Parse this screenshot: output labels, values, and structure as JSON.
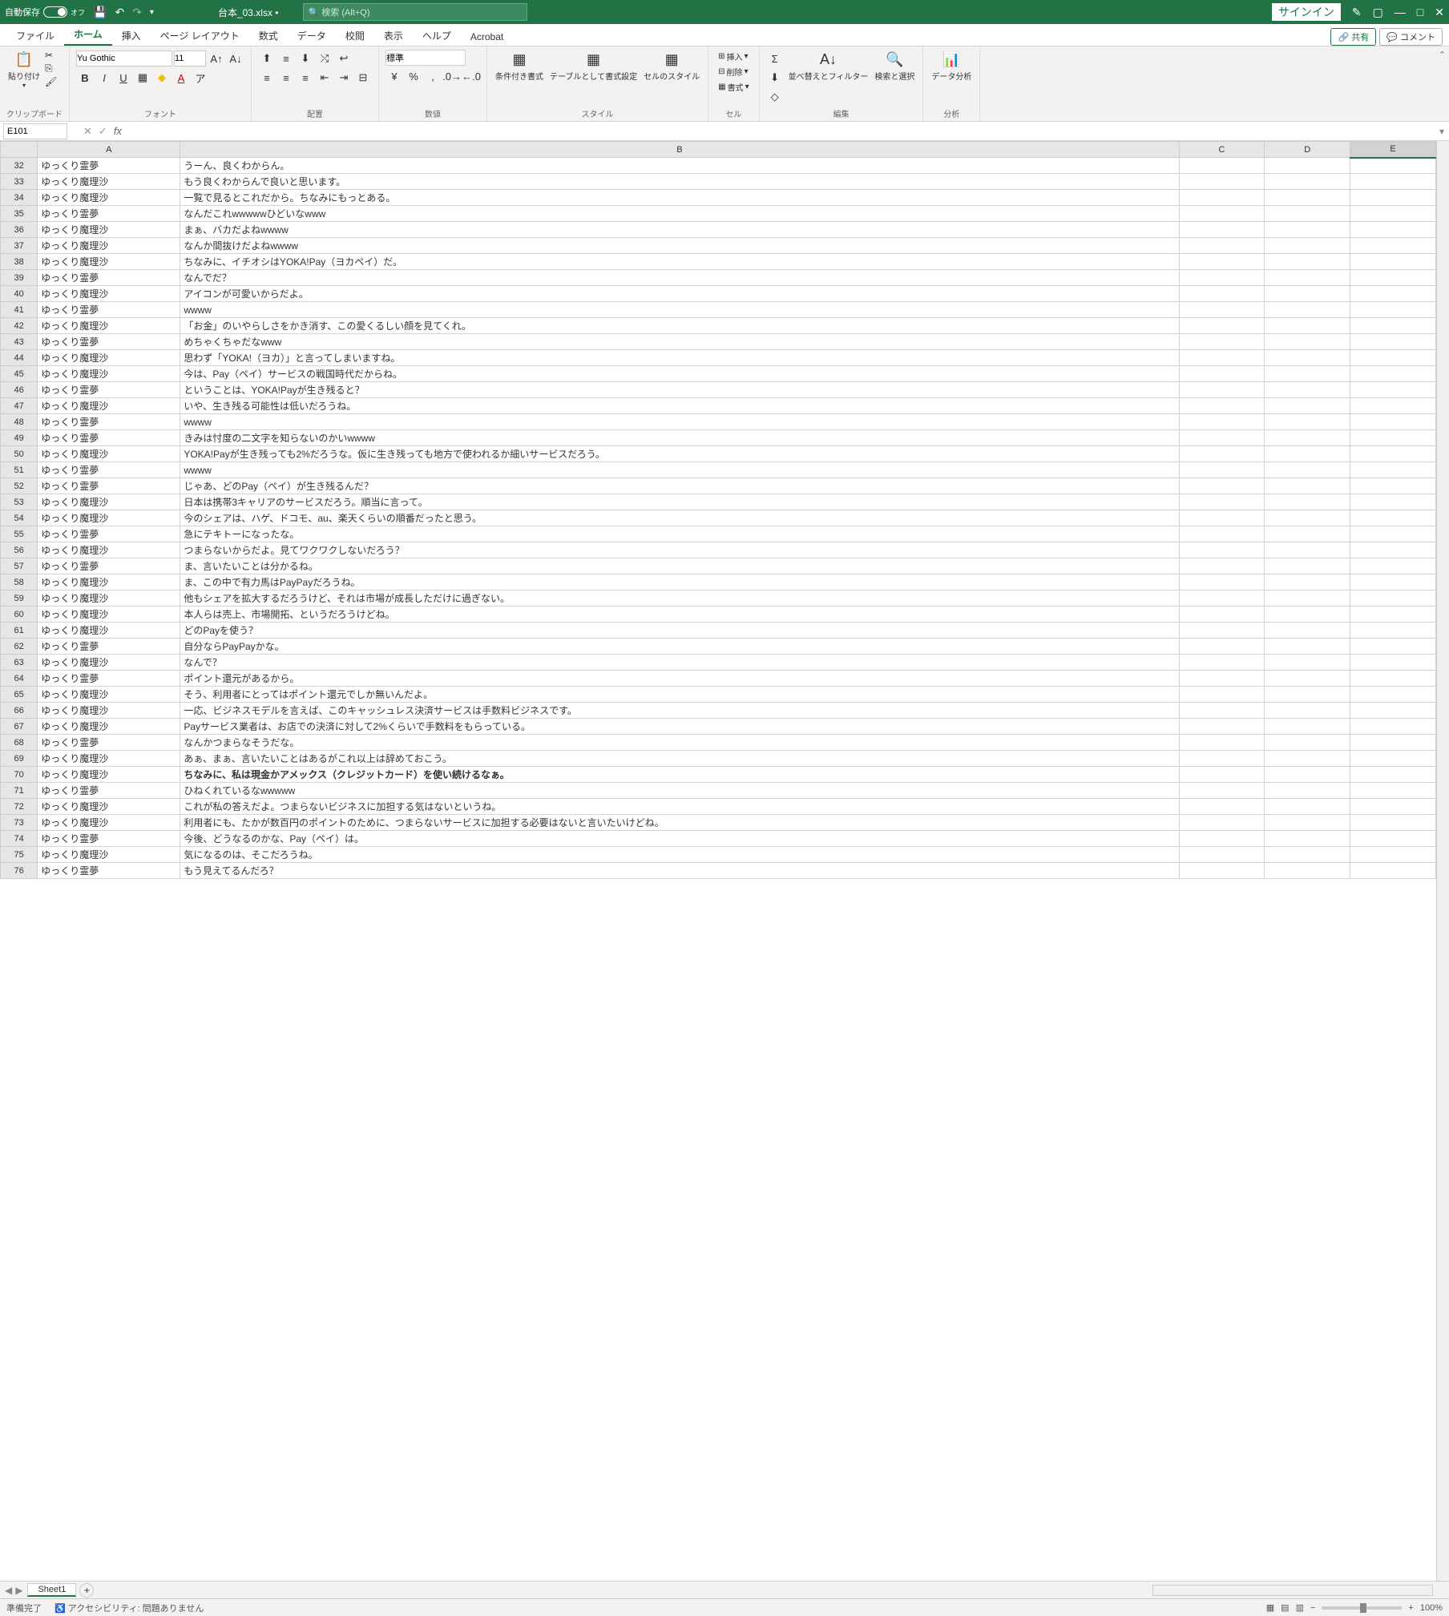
{
  "titlebar": {
    "autosave": "自動保存",
    "autosave_state": "オフ",
    "filename": "台本_03.xlsx •",
    "search_placeholder": "検索 (Alt+Q)",
    "signin": "サインイン"
  },
  "tabs": {
    "file": "ファイル",
    "home": "ホーム",
    "insert": "挿入",
    "layout": "ページ レイアウト",
    "formulas": "数式",
    "data": "データ",
    "review": "校閲",
    "view": "表示",
    "help": "ヘルプ",
    "acrobat": "Acrobat",
    "share": "共有",
    "comment": "コメント"
  },
  "ribbon": {
    "clipboard": "クリップボード",
    "paste": "貼り付け",
    "font_group": "フォント",
    "font_name": "Yu Gothic",
    "font_size": "11",
    "align": "配置",
    "number": "数値",
    "number_format": "標準",
    "style": "スタイル",
    "cond": "条件付き書式",
    "table_fmt": "テーブルとして書式設定",
    "cell_style": "セルのスタイル",
    "cell": "セル",
    "insert_c": "挿入",
    "delete_c": "削除",
    "format_c": "書式",
    "edit": "編集",
    "sort": "並べ替えとフィルター",
    "find": "検索と選択",
    "analysis": "分析",
    "data_analysis": "データ分析"
  },
  "namebox": "E101",
  "cols": [
    "A",
    "B",
    "C",
    "D",
    "E"
  ],
  "rows": [
    {
      "n": 32,
      "a": "ゆっくり霊夢",
      "b": "うーん、良くわからん。"
    },
    {
      "n": 33,
      "a": "ゆっくり魔理沙",
      "b": "もう良くわからんで良いと思います。"
    },
    {
      "n": 34,
      "a": "ゆっくり魔理沙",
      "b": "一覧で見るとこれだから。ちなみにもっとある。"
    },
    {
      "n": 35,
      "a": "ゆっくり霊夢",
      "b": "なんだこれwwwwwひどいなwww"
    },
    {
      "n": 36,
      "a": "ゆっくり魔理沙",
      "b": "まぁ、バカだよねwwww"
    },
    {
      "n": 37,
      "a": "ゆっくり魔理沙",
      "b": "なんか間抜けだよねwwww"
    },
    {
      "n": 38,
      "a": "ゆっくり魔理沙",
      "b": "ちなみに、イチオシはYOKA!Pay（ヨカペイ）だ。"
    },
    {
      "n": 39,
      "a": "ゆっくり霊夢",
      "b": "なんでだ？"
    },
    {
      "n": 40,
      "a": "ゆっくり魔理沙",
      "b": "アイコンが可愛いからだよ。"
    },
    {
      "n": 41,
      "a": "ゆっくり霊夢",
      "b": "wwww"
    },
    {
      "n": 42,
      "a": "ゆっくり魔理沙",
      "b": "「お金」のいやらしさをかき消す、この愛くるしい顔を見てくれ。"
    },
    {
      "n": 43,
      "a": "ゆっくり霊夢",
      "b": "めちゃくちゃだなwww"
    },
    {
      "n": 44,
      "a": "ゆっくり魔理沙",
      "b": "思わず「YOKA!（ヨカ）」と言ってしまいますね。"
    },
    {
      "n": 45,
      "a": "ゆっくり魔理沙",
      "b": "今は、Pay（ペイ）サービスの戦国時代だからね。"
    },
    {
      "n": 46,
      "a": "ゆっくり霊夢",
      "b": "ということは、YOKA!Payが生き残ると？"
    },
    {
      "n": 47,
      "a": "ゆっくり魔理沙",
      "b": "いや、生き残る可能性は低いだろうね。"
    },
    {
      "n": 48,
      "a": "ゆっくり霊夢",
      "b": "wwww"
    },
    {
      "n": 49,
      "a": "ゆっくり霊夢",
      "b": "きみは忖度の二文字を知らないのかいwwww"
    },
    {
      "n": 50,
      "a": "ゆっくり魔理沙",
      "b": "YOKA!Payが生き残っても2%だろうな。仮に生き残っても地方で使われるか細いサービスだろう。"
    },
    {
      "n": 51,
      "a": "ゆっくり霊夢",
      "b": "wwww"
    },
    {
      "n": 52,
      "a": "ゆっくり霊夢",
      "b": "じゃあ、どのPay（ペイ）が生き残るんだ？"
    },
    {
      "n": 53,
      "a": "ゆっくり魔理沙",
      "b": "日本は携帯3キャリアのサービスだろう。順当に言って。"
    },
    {
      "n": 54,
      "a": "ゆっくり魔理沙",
      "b": "今のシェアは、ハゲ、ドコモ、au、楽天くらいの順番だったと思う。"
    },
    {
      "n": 55,
      "a": "ゆっくり霊夢",
      "b": "急にテキトーになったな。"
    },
    {
      "n": 56,
      "a": "ゆっくり魔理沙",
      "b": "つまらないからだよ。見てワクワクしないだろう？"
    },
    {
      "n": 57,
      "a": "ゆっくり霊夢",
      "b": "ま、言いたいことは分かるね。"
    },
    {
      "n": 58,
      "a": "ゆっくり魔理沙",
      "b": "ま、この中で有力馬はPayPayだろうね。"
    },
    {
      "n": 59,
      "a": "ゆっくり魔理沙",
      "b": "他もシェアを拡大するだろうけど、それは市場が成長しただけに過ぎない。"
    },
    {
      "n": 60,
      "a": "ゆっくり魔理沙",
      "b": "本人らは売上、市場開拓、というだろうけどね。"
    },
    {
      "n": 61,
      "a": "ゆっくり魔理沙",
      "b": "どのPayを使う？"
    },
    {
      "n": 62,
      "a": "ゆっくり霊夢",
      "b": "自分ならPayPayかな。"
    },
    {
      "n": 63,
      "a": "ゆっくり魔理沙",
      "b": "なんで？"
    },
    {
      "n": 64,
      "a": "ゆっくり霊夢",
      "b": "ポイント還元があるから。"
    },
    {
      "n": 65,
      "a": "ゆっくり魔理沙",
      "b": "そう、利用者にとってはポイント還元でしか無いんだよ。"
    },
    {
      "n": 66,
      "a": "ゆっくり魔理沙",
      "b": "一応、ビジネスモデルを言えば、このキャッシュレス決済サービスは手数料ビジネスです。"
    },
    {
      "n": 67,
      "a": "ゆっくり魔理沙",
      "b": "Payサービス業者は、お店での決済に対して2%くらいで手数料をもらっている。"
    },
    {
      "n": 68,
      "a": "ゆっくり霊夢",
      "b": "なんかつまらなそうだな。"
    },
    {
      "n": 69,
      "a": "ゆっくり魔理沙",
      "b": "あぁ、まぁ、言いたいことはあるがこれ以上は辞めておこう。"
    },
    {
      "n": 70,
      "a": "ゆっくり魔理沙",
      "b": "ちなみに、私は現金かアメックス（クレジットカード）を使い続けるなぁ。",
      "bold": true
    },
    {
      "n": 71,
      "a": "ゆっくり霊夢",
      "b": "ひねくれているなwwwww"
    },
    {
      "n": 72,
      "a": "ゆっくり魔理沙",
      "b": "これが私の答えだよ。つまらないビジネスに加担する気はないというね。"
    },
    {
      "n": 73,
      "a": "ゆっくり魔理沙",
      "b": "利用者にも、たかが数百円のポイントのために、つまらないサービスに加担する必要はないと言いたいけどね。"
    },
    {
      "n": 74,
      "a": "ゆっくり霊夢",
      "b": "今後、どうなるのかな、Pay（ペイ）は。"
    },
    {
      "n": 75,
      "a": "ゆっくり魔理沙",
      "b": "気になるのは、そこだろうね。"
    },
    {
      "n": 76,
      "a": "ゆっくり霊夢",
      "b": "もう見えてるんだろ？"
    }
  ],
  "sheet": "Sheet1",
  "status": {
    "ready": "準備完了",
    "access": "アクセシビリティ: 問題ありません",
    "zoom": "100%"
  }
}
